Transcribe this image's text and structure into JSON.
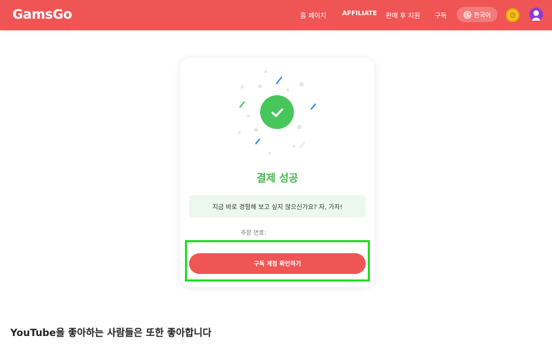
{
  "header": {
    "logo": "GamsGo",
    "nav": [
      "홈 페이지",
      "AFFILIATE",
      "판매 후 지원",
      "구독"
    ],
    "language": "한국어",
    "brand_color": "#f05555"
  },
  "card": {
    "title": "결제 성공",
    "message": "지금 바로 경험해 보고 싶지 않으신가요? 자, 가자!",
    "order_label": "주문 번호:",
    "confirm_button": "구독 계정 확인하기",
    "success_color": "#47c75a"
  },
  "section": {
    "title": "YouTube을 좋아하는 사람들은 또한 좋아합니다"
  },
  "icons": [
    "globe-icon",
    "coin-icon",
    "avatar-icon",
    "check-icon"
  ]
}
